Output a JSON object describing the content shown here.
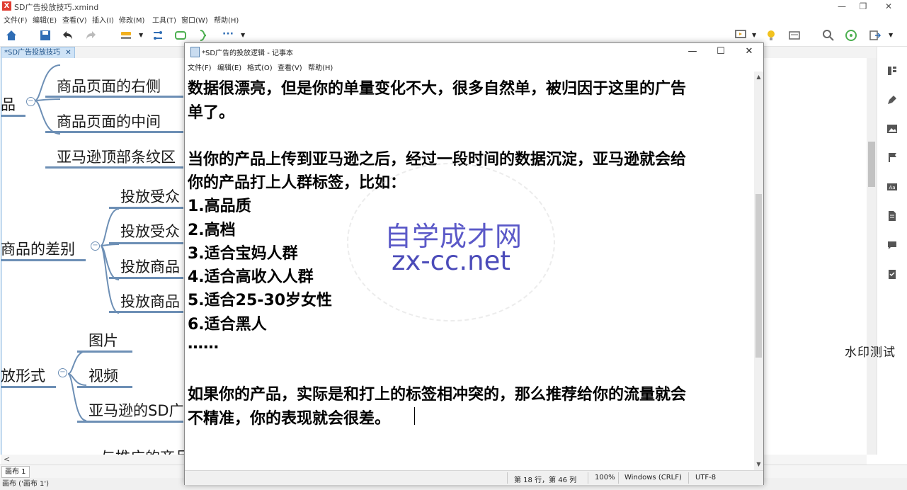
{
  "xmind": {
    "title": "SD广告投放技巧.xmind",
    "menu": [
      "文件(F)",
      "编辑(E)",
      "查看(V)",
      "插入(I)",
      "修改(M)",
      "工具(T)",
      "窗口(W)",
      "帮助(H)"
    ],
    "tab": "*SD广告投放技巧",
    "tab_close": "✕",
    "nodes": {
      "n1": "品",
      "n2": "商品页面的右侧",
      "n3": "商品页面的中间",
      "n4": "亚马逊顶部条纹区",
      "n5": "投放受众",
      "n6": "投放受众",
      "n7": "商品的差别",
      "n8": "投放商品",
      "n9": "投放商品",
      "n10": "图片",
      "n11": "放形式",
      "n12": "视频",
      "n13": "亚马逊的SD广",
      "n14": "与推广的商品"
    },
    "sheet_tab": "画布 1",
    "status": "画布 ('画布 1')",
    "hscroll_left": "<",
    "accent": "#5b9bd5"
  },
  "notepad": {
    "title": "*SD广告的投放逻辑 - 记事本",
    "menu": [
      "文件(F)",
      "编辑(E)",
      "格式(O)",
      "查看(V)",
      "帮助(H)"
    ],
    "lines": [
      "数据很漂亮，但是你的单量变化不大，很多自然单，被归因于这里的广告",
      "单了。",
      "",
      "当你的产品上传到亚马逊之后，经过一段时间的数据沉淀，亚马逊就会给",
      "你的产品打上人群标签，比如：",
      "1.高品质",
      "2.高档",
      "3.适合宝妈人群",
      "4.适合高收入人群",
      "5.适合25-30岁女性",
      "6.适合黑人",
      "……",
      "",
      "如果你的产品，实际是和打上的标签相冲突的，那么推荐给你的流量就会",
      "不精准，你的表现就会很差。"
    ],
    "status": {
      "position": "第 18 行，第 46 列",
      "zoom": "100%",
      "line_ending": "Windows (CRLF)",
      "encoding": "UTF-8"
    }
  },
  "watermark": {
    "cn": "自学成才网",
    "en": "zx-cc.net",
    "side_text": "水印测试"
  }
}
